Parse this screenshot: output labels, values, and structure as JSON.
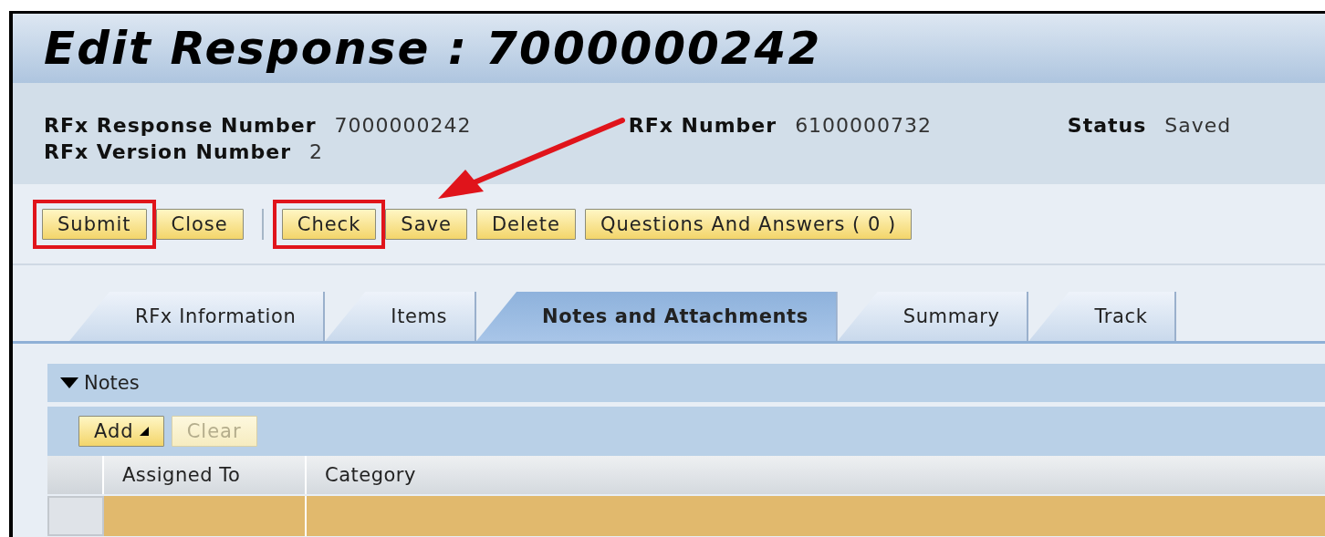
{
  "title": "Edit Response : 7000000242",
  "header_fields": [
    [
      {
        "label": "RFx Response Number",
        "value": "7000000242"
      },
      {
        "label": "RFx Number",
        "value": "6100000732"
      },
      {
        "label": "Status",
        "value": "Saved"
      }
    ],
    [
      {
        "label": "RFx Version Number",
        "value": "2"
      }
    ]
  ],
  "toolbar": [
    [
      {
        "label": "Submit",
        "highlighted": true
      },
      {
        "label": "Close",
        "highlighted": false
      }
    ],
    [
      {
        "label": "Check",
        "highlighted": true
      },
      {
        "label": "Save",
        "highlighted": false
      },
      {
        "label": "Delete",
        "highlighted": false
      },
      {
        "label": "Questions And Answers ( 0 )",
        "highlighted": false
      }
    ]
  ],
  "tabs": [
    {
      "label": "RFx Information",
      "selected": false
    },
    {
      "label": "Items",
      "selected": false
    },
    {
      "label": "Notes and Attachments",
      "selected": true
    },
    {
      "label": "Summary",
      "selected": false
    },
    {
      "label": "Track",
      "selected": false
    }
  ],
  "notes": {
    "title": "Notes",
    "expanded": true,
    "buttons": [
      {
        "label": "Add",
        "kind": "menu",
        "disabled": false
      },
      {
        "label": "Clear",
        "kind": "plain",
        "disabled": true
      }
    ],
    "columns": [
      "Assigned To",
      "Category"
    ],
    "rows": [
      {
        "selected": true
      }
    ]
  }
}
